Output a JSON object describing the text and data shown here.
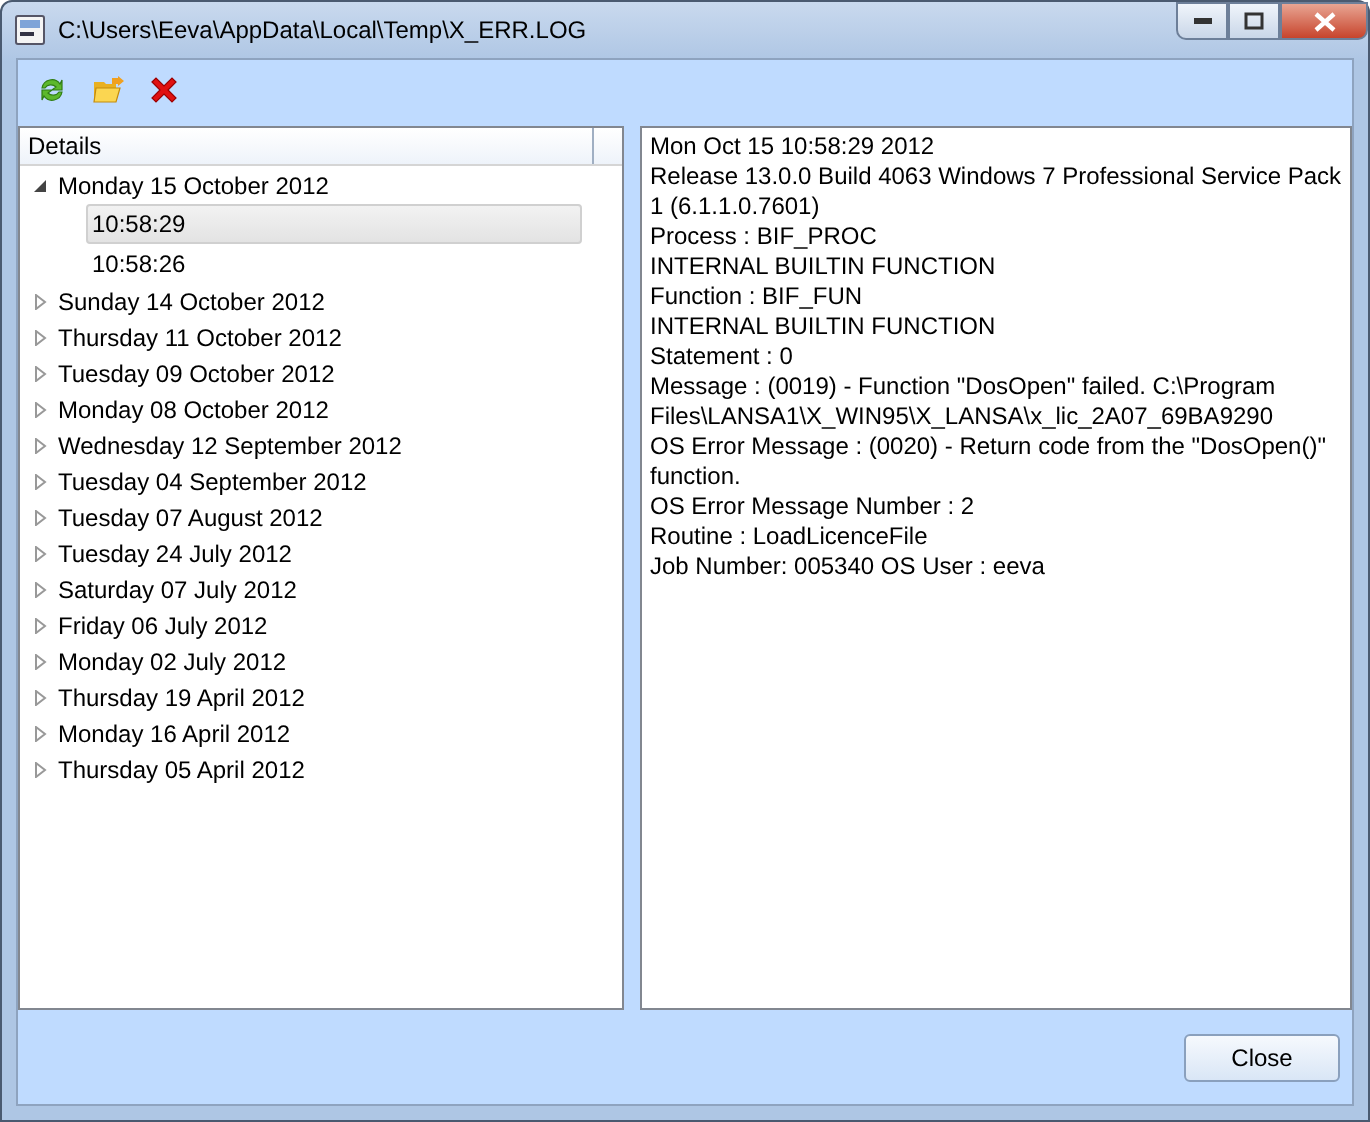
{
  "window": {
    "title": "C:\\Users\\Eeva\\AppData\\Local\\Temp\\X_ERR.LOG"
  },
  "toolbar": [
    {
      "kind": "refresh"
    },
    {
      "kind": "open"
    },
    {
      "kind": "delete"
    }
  ],
  "tree": {
    "header": "Details",
    "items": [
      {
        "label": "Monday 15 October 2012",
        "expanded": true,
        "children": [
          {
            "label": "10:58:29",
            "selected": true
          },
          {
            "label": "10:58:26",
            "selected": false
          }
        ]
      },
      {
        "label": "Sunday 14 October 2012",
        "expanded": false
      },
      {
        "label": "Thursday 11 October 2012",
        "expanded": false
      },
      {
        "label": "Tuesday 09 October 2012",
        "expanded": false
      },
      {
        "label": "Monday 08 October 2012",
        "expanded": false
      },
      {
        "label": "Wednesday 12 September 2012",
        "expanded": false
      },
      {
        "label": "Tuesday 04 September 2012",
        "expanded": false
      },
      {
        "label": "Tuesday 07 August 2012",
        "expanded": false
      },
      {
        "label": "Tuesday 24 July 2012",
        "expanded": false
      },
      {
        "label": "Saturday 07 July 2012",
        "expanded": false
      },
      {
        "label": "Friday 06 July 2012",
        "expanded": false
      },
      {
        "label": "Monday 02 July 2012",
        "expanded": false
      },
      {
        "label": "Thursday 19 April 2012",
        "expanded": false
      },
      {
        "label": "Monday 16 April 2012",
        "expanded": false
      },
      {
        "label": "Thursday 05 April 2012",
        "expanded": false
      }
    ]
  },
  "details": [
    "Mon Oct 15 10:58:29 2012",
    "Release 13.0.0 Build 4063 Windows 7 Professional Service Pack 1 (6.1.1.0.7601)",
    "Process : BIF_PROC",
    "INTERNAL BUILTIN FUNCTION",
    "Function : BIF_FUN",
    "INTERNAL BUILTIN FUNCTION",
    "Statement : 0",
    "Message : (0019) - Function \"DosOpen\" failed. C:\\Program Files\\LANSA1\\X_WIN95\\X_LANSA\\x_lic_2A07_69BA9290",
    "OS Error Message : (0020) - Return code from the \"DosOpen()\" function.",
    "OS Error Message Number : 2",
    "Routine : LoadLicenceFile",
    "Job Number: 005340 OS User : eeva"
  ],
  "buttons": [
    {
      "label": "Close"
    }
  ]
}
